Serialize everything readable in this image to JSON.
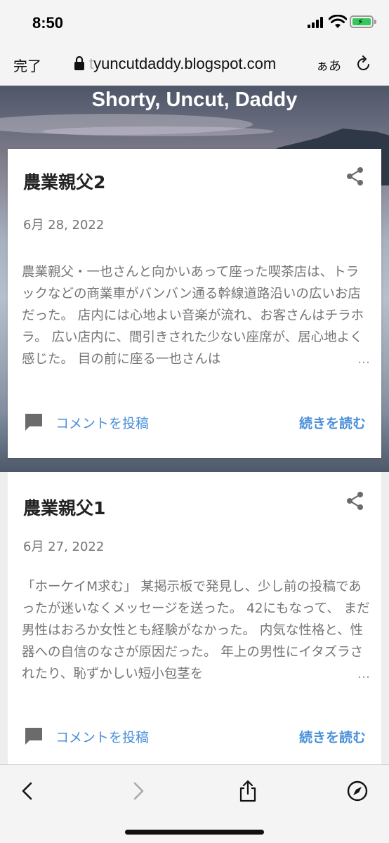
{
  "status_bar": {
    "time": "8:50",
    "icons": [
      "cellular-signal-icon",
      "wifi-icon",
      "battery-charging-icon"
    ],
    "battery_color": "#34c759"
  },
  "address_bar": {
    "done_label": "完了",
    "url_prefix": "t",
    "url_rest": "yuncutdaddy.blogspot.com",
    "text_size_label": "ぁあ",
    "icons": [
      "lock-icon",
      "reload-icon"
    ]
  },
  "blog": {
    "title": "Shorty, Uncut, Daddy"
  },
  "posts": [
    {
      "title": "農業親父2",
      "date": "6月 28, 2022",
      "snippet": "農業親父・一也さんと向かいあって座った喫茶店は、トラックなどの商業車がバンバン通る幹線道路沿いの広いお店だった。 店内には心地よい音楽が流れ、お客さんはチラホラ。 広い店内に、間引きされた少ない座席が、居心地よく感じた。 目の前に座る一也さんは",
      "comment_label": "コメントを投稿",
      "read_more_label": "続きを読む"
    },
    {
      "title": "農業親父1",
      "date": "6月 27, 2022",
      "snippet": "「ホーケイM求む」 某掲示板で発見し、少し前の投稿であったが迷いなくメッセージを送った。 42にもなって、 まだ男性はおろか女性とも経験がなかった。 内気な性格と、性器への自信のなさが原因だった。 年上の男性にイタズラされたり、恥ずかしい短小包茎を",
      "comment_label": "コメントを投稿",
      "read_more_label": "続きを読む"
    }
  ],
  "ellipsis": "…",
  "toolbar": {
    "icons": [
      "back-icon",
      "forward-icon",
      "share-icon",
      "compass-icon"
    ]
  },
  "colors": {
    "link": "#4a90d9",
    "muted_text": "#757575"
  }
}
